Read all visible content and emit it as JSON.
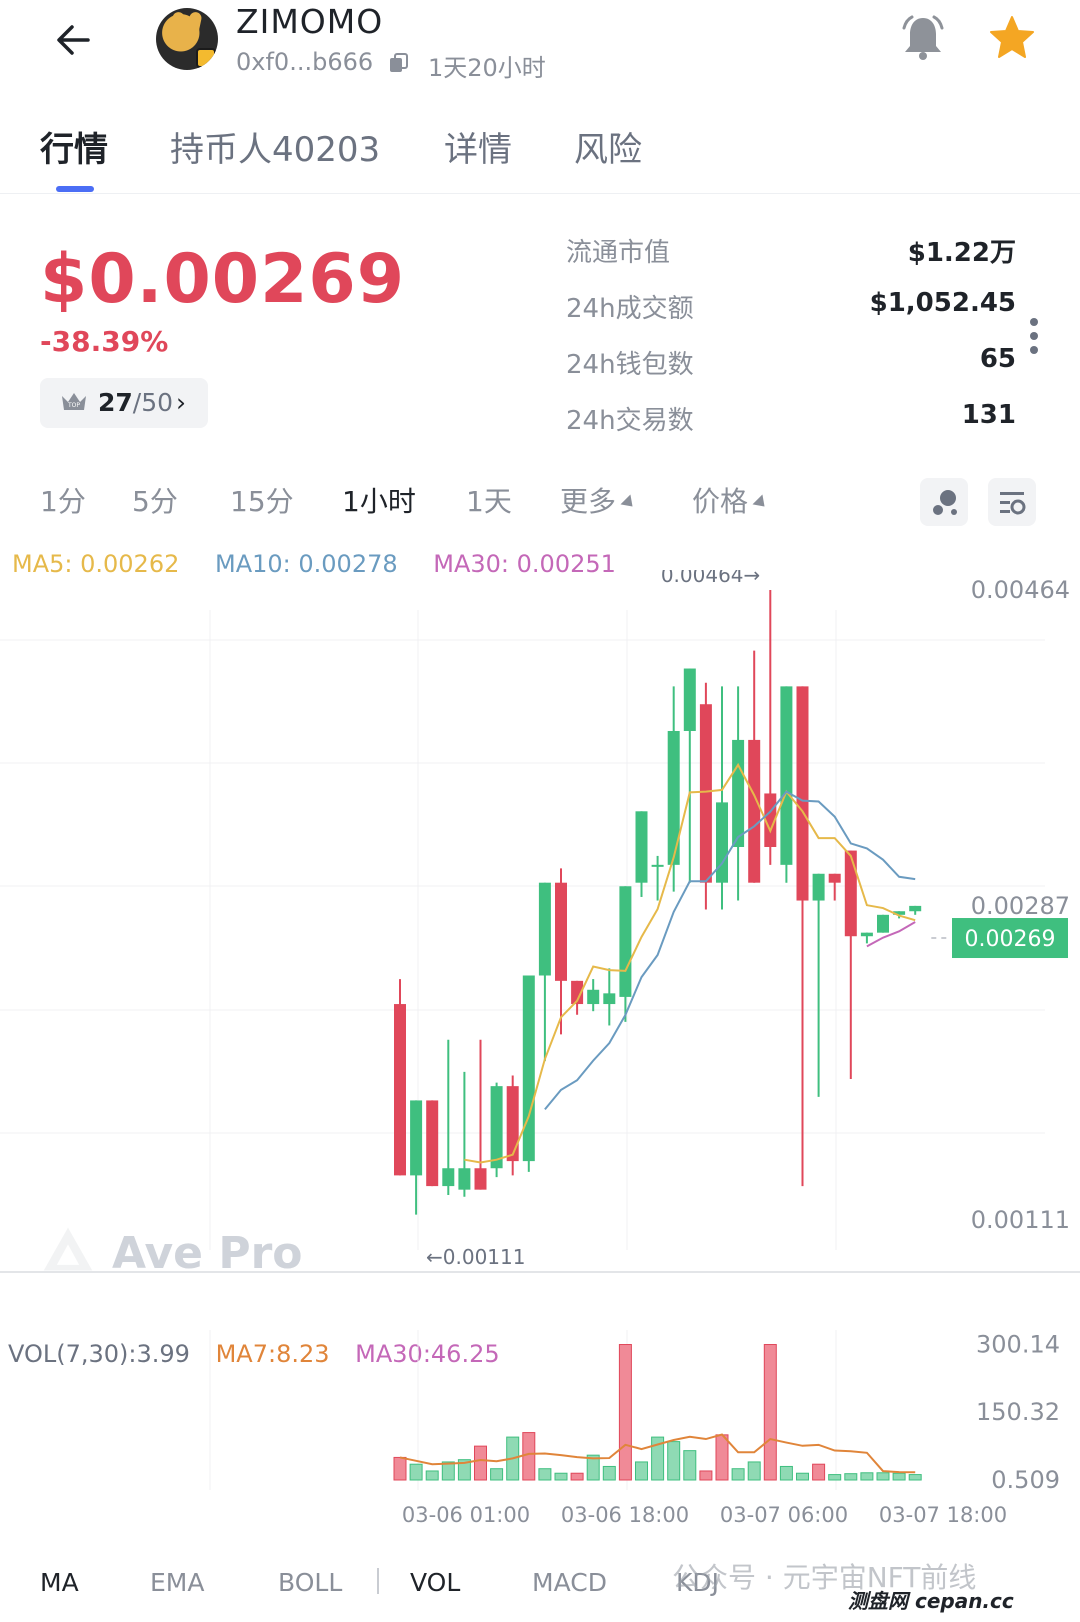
{
  "header": {
    "token_name": "ZIMOMO",
    "address": "0xf0...b666",
    "age": "1天20小时"
  },
  "tabs": [
    {
      "label": "行情",
      "active": true
    },
    {
      "label": "持币人40203",
      "active": false
    },
    {
      "label": "详情",
      "active": false
    },
    {
      "label": "风险",
      "active": false
    }
  ],
  "price": {
    "value": "$0.00269",
    "change": "-38.39%",
    "rank": "27",
    "rank_total": "/50"
  },
  "stats": [
    {
      "label": "流通市值",
      "value": "$1.22万"
    },
    {
      "label": "24h成交额",
      "value": "$1,052.45"
    },
    {
      "label": "24h钱包数",
      "value": "65"
    },
    {
      "label": "24h交易数",
      "value": "131"
    }
  ],
  "timeframes": [
    "1分",
    "5分",
    "15分",
    "1小时",
    "1天",
    "更多",
    "价格"
  ],
  "active_timeframe": "1小时",
  "ma_legend": {
    "ma5": "MA5: 0.00262",
    "ma10": "MA10: 0.00278",
    "ma30": "MA30: 0.00251"
  },
  "colors": {
    "up": "#3fbf7f",
    "down": "#e0475a",
    "ma5": "#e6b94a",
    "ma10": "#6a9bc0",
    "ma30": "#c468b8",
    "accent": "#4b6ef5"
  },
  "chart_data": [
    {
      "type": "candlestick",
      "title": "",
      "y_axis_labels": [
        "0.00464",
        "0.00287",
        "0.00111"
      ],
      "ylim": [
        0.00111,
        0.00464
      ],
      "current_price_label": "0.00269",
      "current_price": 0.00269,
      "high_annotation": "0.00464→",
      "low_annotation": "←0.00111",
      "candles": [
        {
          "o": 0.00232,
          "h": 0.00246,
          "l": 0.00136,
          "c": 0.00136
        },
        {
          "o": 0.00136,
          "h": 0.00178,
          "l": 0.00114,
          "c": 0.00178
        },
        {
          "o": 0.00178,
          "h": 0.00178,
          "l": 0.0013,
          "c": 0.0013
        },
        {
          "o": 0.0013,
          "h": 0.00212,
          "l": 0.00125,
          "c": 0.0014
        },
        {
          "o": 0.00128,
          "h": 0.00194,
          "l": 0.00124,
          "c": 0.0014
        },
        {
          "o": 0.0014,
          "h": 0.00212,
          "l": 0.00128,
          "c": 0.00128
        },
        {
          "o": 0.0014,
          "h": 0.00188,
          "l": 0.00135,
          "c": 0.00186
        },
        {
          "o": 0.00186,
          "h": 0.00192,
          "l": 0.00136,
          "c": 0.00144
        },
        {
          "o": 0.00144,
          "h": 0.00248,
          "l": 0.00138,
          "c": 0.00248
        },
        {
          "o": 0.00248,
          "h": 0.003,
          "l": 0.002,
          "c": 0.003
        },
        {
          "o": 0.003,
          "h": 0.00308,
          "l": 0.00215,
          "c": 0.00245
        },
        {
          "o": 0.00245,
          "h": 0.0024,
          "l": 0.00226,
          "c": 0.00232
        },
        {
          "o": 0.00232,
          "h": 0.00246,
          "l": 0.00228,
          "c": 0.0024
        },
        {
          "o": 0.00232,
          "h": 0.00252,
          "l": 0.0022,
          "c": 0.00238
        },
        {
          "o": 0.00236,
          "h": 0.00298,
          "l": 0.00222,
          "c": 0.00298
        },
        {
          "o": 0.003,
          "h": 0.00338,
          "l": 0.00292,
          "c": 0.0034
        },
        {
          "o": 0.0031,
          "h": 0.00315,
          "l": 0.0029,
          "c": 0.0031
        },
        {
          "o": 0.0031,
          "h": 0.0041,
          "l": 0.00295,
          "c": 0.00385
        },
        {
          "o": 0.00385,
          "h": 0.00412,
          "l": 0.003,
          "c": 0.0042
        },
        {
          "o": 0.004,
          "h": 0.00412,
          "l": 0.00285,
          "c": 0.003
        },
        {
          "o": 0.003,
          "h": 0.0041,
          "l": 0.00285,
          "c": 0.00345
        },
        {
          "o": 0.0032,
          "h": 0.0041,
          "l": 0.0029,
          "c": 0.0038
        },
        {
          "o": 0.0038,
          "h": 0.0043,
          "l": 0.003,
          "c": 0.003
        },
        {
          "o": 0.0035,
          "h": 0.00464,
          "l": 0.0031,
          "c": 0.0032
        },
        {
          "o": 0.0031,
          "h": 0.0039,
          "l": 0.003,
          "c": 0.0041
        },
        {
          "o": 0.0041,
          "h": 0.0041,
          "l": 0.0013,
          "c": 0.0029
        },
        {
          "o": 0.0029,
          "h": 0.00305,
          "l": 0.0018,
          "c": 0.00305
        },
        {
          "o": 0.00305,
          "h": 0.003,
          "l": 0.0029,
          "c": 0.003
        },
        {
          "o": 0.00318,
          "h": 0.00318,
          "l": 0.0019,
          "c": 0.0027
        },
        {
          "o": 0.0027,
          "h": 0.00272,
          "l": 0.00266,
          "c": 0.00272
        },
        {
          "o": 0.00272,
          "h": 0.00282,
          "l": 0.00272,
          "c": 0.00282
        },
        {
          "o": 0.00282,
          "h": 0.00284,
          "l": 0.0028,
          "c": 0.00284
        },
        {
          "o": 0.00284,
          "h": 0.00287,
          "l": 0.00282,
          "c": 0.00287
        }
      ]
    },
    {
      "type": "bar",
      "title": "",
      "legend": [
        "VOL(7,30):3.99",
        "MA7:8.23",
        "MA30:46.25"
      ],
      "y_axis_labels": [
        "300.14",
        "150.32",
        "0.509"
      ],
      "ylim": [
        0,
        310
      ],
      "x_axis_labels": [
        "03-06 01:00",
        "03-06 18:00",
        "03-07 06:00",
        "03-07 18:00"
      ],
      "values": [
        50,
        35,
        20,
        40,
        45,
        75,
        25,
        95,
        105,
        25,
        15,
        15,
        55,
        30,
        300,
        40,
        95,
        85,
        65,
        20,
        100,
        25,
        40,
        300,
        30,
        15,
        35,
        12,
        14,
        16,
        16,
        15,
        12
      ],
      "colors_up": [
        false,
        true,
        true,
        true,
        true,
        false,
        true,
        true,
        false,
        true,
        true,
        false,
        true,
        true,
        false,
        true,
        true,
        true,
        true,
        false,
        false,
        true,
        true,
        false,
        true,
        true,
        false,
        true,
        true,
        true,
        true,
        true,
        true
      ]
    }
  ],
  "indicators": [
    "MA",
    "EMA",
    "BOLL",
    "VOL",
    "MACD",
    "KDJ"
  ],
  "active_indicators": [
    "MA",
    "VOL"
  ],
  "watermark": "Ave Pro",
  "footer": {
    "wechat": "公众号 · 元宇宙NFT前线",
    "brand": "测盘网 cepan.cc"
  }
}
